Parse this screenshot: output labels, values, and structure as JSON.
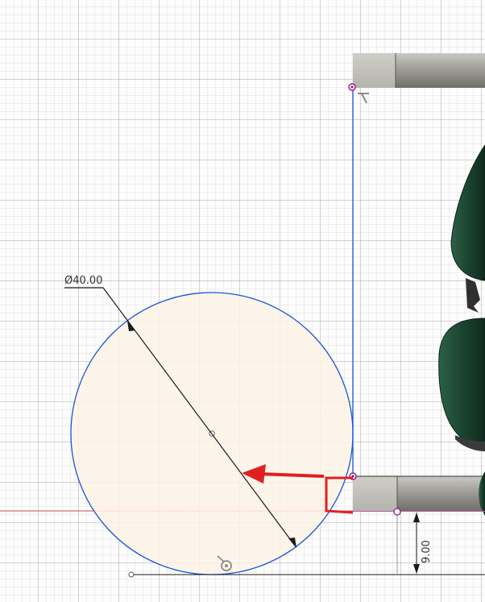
{
  "sketch": {
    "diameter_dimension": "Ø40.00",
    "height_dimension": "9.00"
  },
  "colors": {
    "sketch_line": "#1a56d6",
    "circle_fill": "#fdf2e6",
    "origin_axis": "#e0454a",
    "annotation_arrow": "#e02020",
    "constraint_point": "#9b1c8a",
    "body_gray": "#8a8a84",
    "body_green": "#1f4a33"
  },
  "icons": [
    "tangent-constraint-icon",
    "fix-constraint-icon",
    "coincident-point-icon"
  ]
}
